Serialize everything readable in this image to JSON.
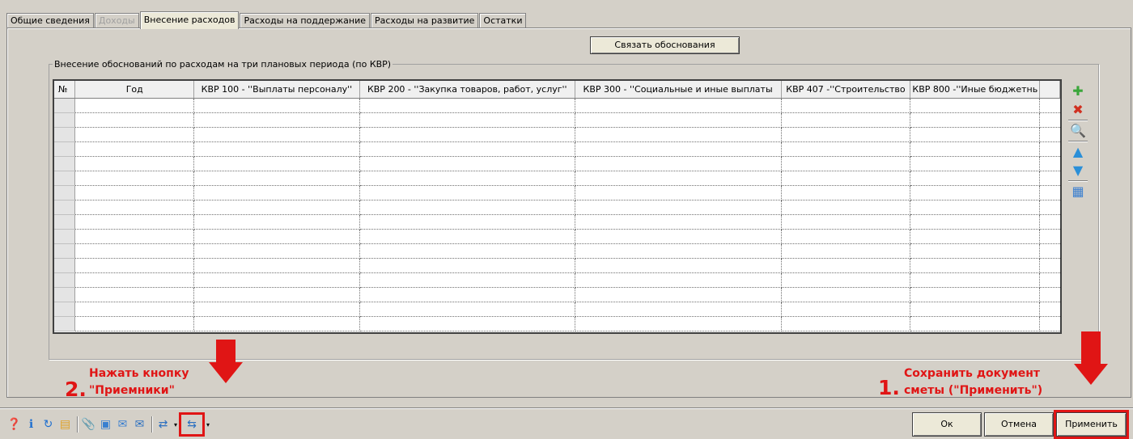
{
  "tabs": [
    {
      "label": "Общие сведения",
      "state": "normal"
    },
    {
      "label": "Доходы",
      "state": "disabled"
    },
    {
      "label": "Внесение расходов",
      "state": "active"
    },
    {
      "label": "Расходы на поддержание",
      "state": "normal"
    },
    {
      "label": "Расходы  на развитие",
      "state": "normal"
    },
    {
      "label": "Остатки",
      "state": "normal"
    }
  ],
  "link_button": "Связать обоснования",
  "group": {
    "title": "Внесение обоснований по расходам на три плановых периода (по КВР)"
  },
  "grid": {
    "columns": [
      "№",
      "Год",
      "КВР 100 - ''Выплаты персоналу''",
      "КВР 200 - ''Закупка товаров, работ, услуг''",
      "КВР 300 - ''Социальные и иные выплаты",
      "КВР 407 -''Строительство",
      "КВР 800 -''Иные бюджетнь"
    ],
    "empty_row_count": 16
  },
  "side_toolbar": [
    {
      "name": "add-icon",
      "glyph": "✚",
      "color": "#3aa63a"
    },
    {
      "name": "delete-icon",
      "glyph": "✖",
      "color": "#d03020"
    },
    {
      "name": "sep"
    },
    {
      "name": "search-icon",
      "glyph": "🔍",
      "color": "#c08020"
    },
    {
      "name": "sep"
    },
    {
      "name": "move-up-icon",
      "glyph": "▲",
      "color": "#2a8fd8"
    },
    {
      "name": "move-down-icon",
      "glyph": "▼",
      "color": "#2a8fd8"
    },
    {
      "name": "sep"
    },
    {
      "name": "calculator-icon",
      "glyph": "▦",
      "color": "#3a7fd0"
    }
  ],
  "bottom_toolbar": [
    {
      "name": "help-icon",
      "glyph": "❓",
      "color": "#3aa63a"
    },
    {
      "name": "info-icon",
      "glyph": "ℹ",
      "color": "#1e6fd0"
    },
    {
      "name": "refresh-icon",
      "glyph": "↻",
      "color": "#1e6fd0"
    },
    {
      "name": "documents-icon",
      "glyph": "▤",
      "color": "#e0a020"
    },
    {
      "name": "sep"
    },
    {
      "name": "attachment-icon",
      "glyph": "📎",
      "color": "#606060"
    },
    {
      "name": "user-card-icon",
      "glyph": "▣",
      "color": "#3a7fd0"
    },
    {
      "name": "mail-forward-icon",
      "glyph": "✉",
      "color": "#3a7fd0"
    },
    {
      "name": "mail-icon",
      "glyph": "✉",
      "color": "#2a6fc0"
    },
    {
      "name": "sep"
    },
    {
      "name": "export-icon",
      "glyph": "⇄",
      "color": "#2a6fc0"
    },
    {
      "name": "dropdown-arrow-icon",
      "glyph": "▾",
      "color": "#000000"
    },
    {
      "name": "receivers-icon",
      "glyph": "⇆",
      "color": "#2a6fc0",
      "highlight": true
    },
    {
      "name": "dropdown-arrow-icon",
      "glyph": "▾",
      "color": "#000000"
    }
  ],
  "buttons": {
    "ok": "Ок",
    "cancel": "Отмена",
    "apply": "Применить"
  },
  "annotations": {
    "step1_number": "1.",
    "step1_line1": "Сохранить документ",
    "step1_line2": "сметы (\"Применить\")",
    "step2_number": "2.",
    "step2_line1": "Нажать кнопку",
    "step2_line2": "\"Приемники\"",
    "color": "#e01515"
  }
}
